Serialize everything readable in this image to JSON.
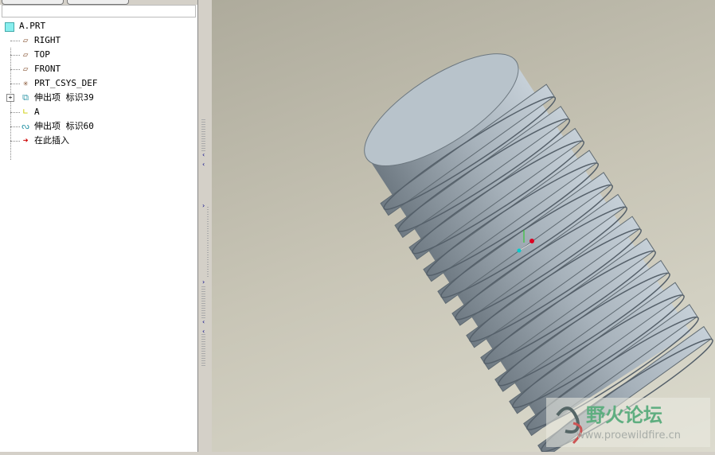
{
  "tree": {
    "root": "A.PRT",
    "items": [
      {
        "label": "RIGHT",
        "icon": "datum-plane-icon"
      },
      {
        "label": "TOP",
        "icon": "datum-plane-icon"
      },
      {
        "label": "FRONT",
        "icon": "datum-plane-icon"
      },
      {
        "label": "PRT_CSYS_DEF",
        "icon": "csys-icon"
      },
      {
        "label": "伸出项 标识39",
        "icon": "extrude-icon"
      },
      {
        "label": "A",
        "icon": "datum-axis-icon"
      },
      {
        "label": "伸出项 标识60",
        "icon": "helical-sweep-icon"
      },
      {
        "label": "在此插入",
        "icon": "insert-here-icon"
      }
    ]
  },
  "watermark": {
    "title": "野火论坛",
    "url": "www.proewildfire.cn"
  },
  "colors": {
    "part": "#a9b4bd",
    "background": "#c8c5b6"
  }
}
